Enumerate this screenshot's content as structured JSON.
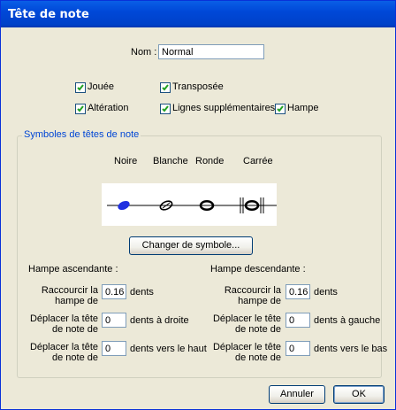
{
  "window": {
    "title": "Tête de note"
  },
  "nom": {
    "label": "Nom :",
    "value": "Normal"
  },
  "checkboxes": {
    "jouee": "Jouée",
    "transposee": "Transposée",
    "alteration": "Altération",
    "lignes": "Lignes supplémentaires",
    "hampe": "Hampe"
  },
  "group": {
    "title": "Symboles de têtes de note",
    "columns": [
      "Noire",
      "Blanche",
      "Ronde",
      "Carrée"
    ],
    "change_button": "Changer de symbole..."
  },
  "asc": {
    "title": "Hampe ascendante :",
    "shorten_l1": "Raccourcir la",
    "shorten_l2": "hampe de",
    "shorten_value": "0.16",
    "shorten_unit": "dents",
    "movex_l1": "Déplacer la tête",
    "movex_l2": "de note de",
    "movex_value": "0",
    "movex_unit": "dents à droite",
    "movey_l1": "Déplacer la tête",
    "movey_l2": "de note de",
    "movey_value": "0",
    "movey_unit": "dents vers le haut"
  },
  "desc": {
    "title": "Hampe descendante :",
    "shorten_l1": "Raccourcir la",
    "shorten_l2": "hampe de",
    "shorten_value": "0.16",
    "shorten_unit": "dents",
    "movex_l1": "Déplacer le tête",
    "movex_l2": "de note de",
    "movex_value": "0",
    "movex_unit": "dents à gauche",
    "movey_l1": "Déplacer le tête",
    "movey_l2": "de note de",
    "movey_value": "0",
    "movey_unit": "dents vers le bas"
  },
  "buttons": {
    "cancel": "Annuler",
    "ok": "OK"
  },
  "colors": {
    "accent": "#0046d5",
    "title_bar": "#0050e0",
    "face": "#ece9d8"
  }
}
